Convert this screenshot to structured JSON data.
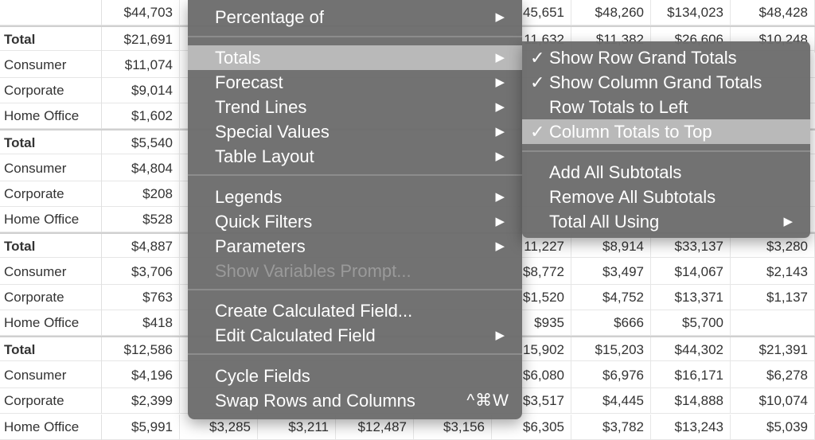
{
  "table": {
    "rows": [
      {
        "label": "",
        "total": false,
        "values": [
          "$44,703",
          "",
          "",
          "",
          "",
          "45,651",
          "$48,260",
          "$134,023",
          "$48,428"
        ]
      },
      {
        "label": "Total",
        "total": true,
        "values": [
          "$21,691",
          "",
          "",
          "",
          "",
          "11,632",
          "$11,382",
          "$26,606",
          "$10,248"
        ]
      },
      {
        "label": "Consumer",
        "total": false,
        "values": [
          "$11,074",
          "",
          "",
          "",
          "",
          "",
          "",
          "",
          ""
        ]
      },
      {
        "label": "Corporate",
        "total": false,
        "values": [
          "$9,014",
          "",
          "",
          "",
          "",
          "",
          "",
          "",
          ""
        ]
      },
      {
        "label": "Home Office",
        "total": false,
        "values": [
          "$1,602",
          "",
          "",
          "",
          "",
          "",
          "",
          "",
          ""
        ]
      },
      {
        "label": "Total",
        "total": true,
        "values": [
          "$5,540",
          "",
          "",
          "",
          "",
          "",
          "",
          "",
          ""
        ]
      },
      {
        "label": "Consumer",
        "total": false,
        "values": [
          "$4,804",
          "",
          "",
          "",
          "",
          "",
          "",
          "",
          ""
        ]
      },
      {
        "label": "Corporate",
        "total": false,
        "values": [
          "$208",
          "",
          "",
          "",
          "",
          "",
          "",
          "",
          ""
        ]
      },
      {
        "label": "Home Office",
        "total": false,
        "values": [
          "$528",
          "",
          "",
          "",
          "",
          "",
          "",
          "",
          ""
        ]
      },
      {
        "label": "Total",
        "total": true,
        "values": [
          "$4,887",
          "",
          "",
          "",
          "",
          "11,227",
          "$8,914",
          "$33,137",
          "$3,280"
        ]
      },
      {
        "label": "Consumer",
        "total": false,
        "values": [
          "$3,706",
          "",
          "",
          "",
          "",
          "$8,772",
          "$3,497",
          "$14,067",
          "$2,143"
        ]
      },
      {
        "label": "Corporate",
        "total": false,
        "values": [
          "$763",
          "",
          "",
          "",
          "",
          "$1,520",
          "$4,752",
          "$13,371",
          "$1,137"
        ]
      },
      {
        "label": "Home Office",
        "total": false,
        "values": [
          "$418",
          "",
          "",
          "",
          "",
          "$935",
          "$666",
          "$5,700",
          ""
        ]
      },
      {
        "label": "Total",
        "total": true,
        "values": [
          "$12,586",
          "",
          "",
          "",
          "",
          "15,902",
          "$15,203",
          "$44,302",
          "$21,391"
        ]
      },
      {
        "label": "Consumer",
        "total": false,
        "values": [
          "$4,196",
          "",
          "",
          "",
          "",
          "$6,080",
          "$6,976",
          "$16,171",
          "$6,278"
        ]
      },
      {
        "label": "Corporate",
        "total": false,
        "values": [
          "$2,399",
          "",
          "",
          "",
          "",
          "$3,517",
          "$4,445",
          "$14,888",
          "$10,074"
        ]
      },
      {
        "label": "Home Office",
        "total": false,
        "values": [
          "$5,991",
          "$3,285",
          "$3,211",
          "$12,487",
          "$3,156",
          "$6,305",
          "$3,782",
          "$13,243",
          "$5,039"
        ]
      }
    ]
  },
  "main_menu": {
    "items": [
      {
        "label": "Percentage of",
        "submenu": true,
        "disabled": false,
        "highlighted": false
      },
      {
        "label": "Totals",
        "submenu": true,
        "disabled": false,
        "highlighted": true
      },
      {
        "label": "Forecast",
        "submenu": true,
        "disabled": false,
        "highlighted": false
      },
      {
        "label": "Trend Lines",
        "submenu": true,
        "disabled": false,
        "highlighted": false
      },
      {
        "label": "Special Values",
        "submenu": true,
        "disabled": false,
        "highlighted": false
      },
      {
        "label": "Table Layout",
        "submenu": true,
        "disabled": false,
        "highlighted": false
      },
      {
        "label": "Legends",
        "submenu": true,
        "disabled": false,
        "highlighted": false
      },
      {
        "label": "Quick Filters",
        "submenu": true,
        "disabled": false,
        "highlighted": false
      },
      {
        "label": "Parameters",
        "submenu": true,
        "disabled": false,
        "highlighted": false
      },
      {
        "label": "Show Variables Prompt...",
        "submenu": false,
        "disabled": true,
        "highlighted": false
      },
      {
        "label": "Create Calculated Field...",
        "submenu": false,
        "disabled": false,
        "highlighted": false
      },
      {
        "label": "Edit Calculated Field",
        "submenu": true,
        "disabled": false,
        "highlighted": false
      },
      {
        "label": "Cycle Fields",
        "submenu": false,
        "disabled": false,
        "highlighted": false
      },
      {
        "label": "Swap Rows and Columns",
        "submenu": false,
        "disabled": false,
        "highlighted": false,
        "shortcut": "^⌘W"
      }
    ]
  },
  "totals_submenu": {
    "items": [
      {
        "label": "Show Row Grand Totals",
        "checked": true,
        "highlighted": false,
        "submenu": false
      },
      {
        "label": "Show Column Grand Totals",
        "checked": true,
        "highlighted": false,
        "submenu": false
      },
      {
        "label": "Row Totals to Left",
        "checked": false,
        "highlighted": false,
        "submenu": false
      },
      {
        "label": "Column Totals to Top",
        "checked": true,
        "highlighted": true,
        "submenu": false
      },
      {
        "label": "Add All Subtotals",
        "checked": false,
        "highlighted": false,
        "submenu": false
      },
      {
        "label": "Remove All Subtotals",
        "checked": false,
        "highlighted": false,
        "submenu": false
      },
      {
        "label": "Total All Using",
        "checked": false,
        "highlighted": false,
        "submenu": true
      }
    ]
  },
  "glyphs": {
    "submenu_arrow": "▶",
    "checkmark": "✓"
  },
  "colors": {
    "menu_bg": "#6c6c6c",
    "menu_highlight": "#b9b9b9",
    "menu_text": "#ffffff",
    "disabled_text": "#9a9a9a"
  }
}
